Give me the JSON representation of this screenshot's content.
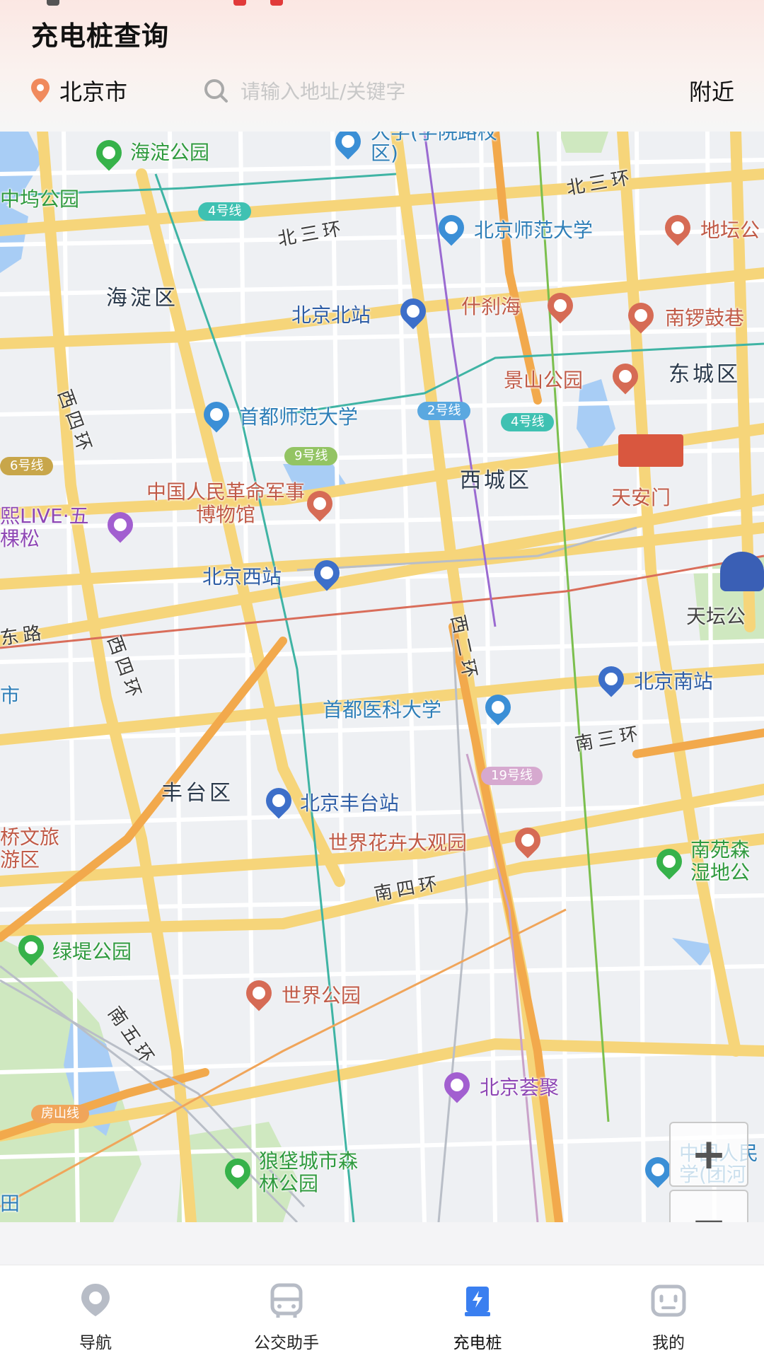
{
  "header": {
    "title": "充电桩查询",
    "city": "北京市",
    "search_placeholder": "请输入地址/关键字",
    "nearby": "附近"
  },
  "map": {
    "districts": [
      "海淀区",
      "东城区",
      "西城区",
      "丰台区"
    ],
    "roads": [
      "北三环",
      "北三环",
      "西四环",
      "西四环",
      "西二环",
      "南三环",
      "南四环",
      "南五环",
      "东路"
    ],
    "parks": [
      "海淀公园",
      "中坞公园",
      "绿堤公园",
      "狼垡城市森林公园",
      "南苑森湿地公"
    ],
    "universities": [
      "大学(学院路校区)",
      "北京师范大学",
      "首都师范大学",
      "首都医科大学",
      "中国人民学(团河"
    ],
    "sights": [
      "什刹海",
      "南锣鼓巷",
      "地坛公",
      "景山公园",
      "天安门",
      "天坛公",
      "中国人民革命军事博物馆",
      "世界花卉大观园",
      "世界公园"
    ],
    "stations": [
      "北京北站",
      "北京西站",
      "北京南站",
      "北京丰台站"
    ],
    "shops": [
      "熙LIVE·五棵松",
      "北京荟聚"
    ],
    "metro_lines": [
      "4号线",
      "2号线",
      "4号线",
      "9号线",
      "6号线",
      "19号线",
      "房山线"
    ],
    "edge_labels": [
      "桥文旅游区",
      "市",
      "田"
    ],
    "zoom_in": "+",
    "zoom_out": "−"
  },
  "tabs": [
    {
      "label": "导航",
      "icon": "location-pin-icon"
    },
    {
      "label": "公交助手",
      "icon": "bus-icon"
    },
    {
      "label": "充电桩",
      "icon": "charging-pile-icon"
    },
    {
      "label": "我的",
      "icon": "profile-icon"
    }
  ],
  "colors": {
    "active_tab": "#3a7ff0",
    "inactive_tab": "#b7bcc6",
    "park": "#2f9a3e",
    "education": "#2f7fb8",
    "sight": "#c05a47",
    "station": "#2f5ea6"
  }
}
